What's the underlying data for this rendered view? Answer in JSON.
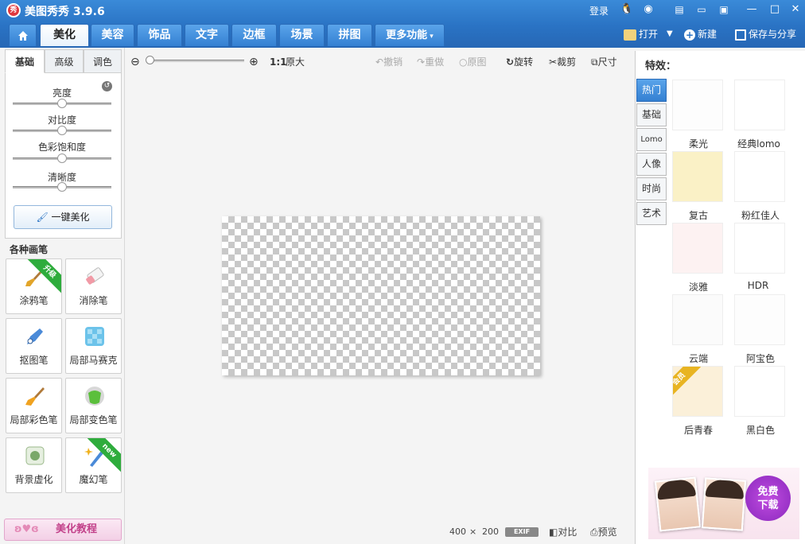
{
  "app": {
    "logo_text": "秀",
    "title": "美图秀秀 3.9.6",
    "login": "登录"
  },
  "nav": {
    "tabs": [
      "美化",
      "美容",
      "饰品",
      "文字",
      "边框",
      "场景",
      "拼图",
      "更多功能"
    ]
  },
  "toolbar_right": {
    "open": "打开",
    "new": "新建",
    "save": "保存与分享"
  },
  "adjust": {
    "tabs": [
      "基础",
      "高级",
      "调色"
    ],
    "sliders": [
      {
        "label": "亮度",
        "value": 0.5
      },
      {
        "label": "对比度",
        "value": 0.5
      },
      {
        "label": "色彩饱和度",
        "value": 0.5
      },
      {
        "label": "清晰度",
        "value": 0.5
      }
    ],
    "one_click": "一键美化"
  },
  "brushes": {
    "title": "各种画笔",
    "items": [
      {
        "label": "涂鸦笔",
        "ribbon": "升级"
      },
      {
        "label": "消除笔"
      },
      {
        "label": "抠图笔"
      },
      {
        "label": "局部马赛克"
      },
      {
        "label": "局部彩色笔"
      },
      {
        "label": "局部变色笔"
      },
      {
        "label": "背景虚化"
      },
      {
        "label": "魔幻笔",
        "ribbon": "new"
      }
    ]
  },
  "tutorial": "美化教程",
  "canvas_toolbar": {
    "ratio": "1:1",
    "original_size": "原大",
    "undo": "撤销",
    "redo": "重做",
    "original": "原图",
    "rotate": "旋转",
    "crop": "裁剪",
    "resize": "尺寸"
  },
  "status": {
    "width": "400",
    "times": "×",
    "height": "200",
    "exif": "EXIF",
    "compare": "对比",
    "preview": "预览"
  },
  "effects": {
    "title": "特效：",
    "categories": [
      "热门",
      "基础",
      "Lomo",
      "人像",
      "时尚",
      "艺术"
    ],
    "items": [
      {
        "label": "柔光",
        "color": "#fdfdfd"
      },
      {
        "label": "经典lomo",
        "color": "#ffffff"
      },
      {
        "label": "复古",
        "color": "#faf1c6"
      },
      {
        "label": "粉红佳人",
        "color": "#ffffff"
      },
      {
        "label": "淡雅",
        "color": "#fdf2f2"
      },
      {
        "label": "HDR",
        "color": "#ffffff"
      },
      {
        "label": "云端",
        "color": "#fbfbfb"
      },
      {
        "label": "阿宝色",
        "color": "#fdfdfd"
      },
      {
        "label": "后青春",
        "color": "#fbf0d9",
        "ribbon": "会员"
      },
      {
        "label": "黑白色",
        "color": "#ffffff"
      }
    ]
  },
  "ad": {
    "line1": "免费",
    "line2": "下载"
  }
}
